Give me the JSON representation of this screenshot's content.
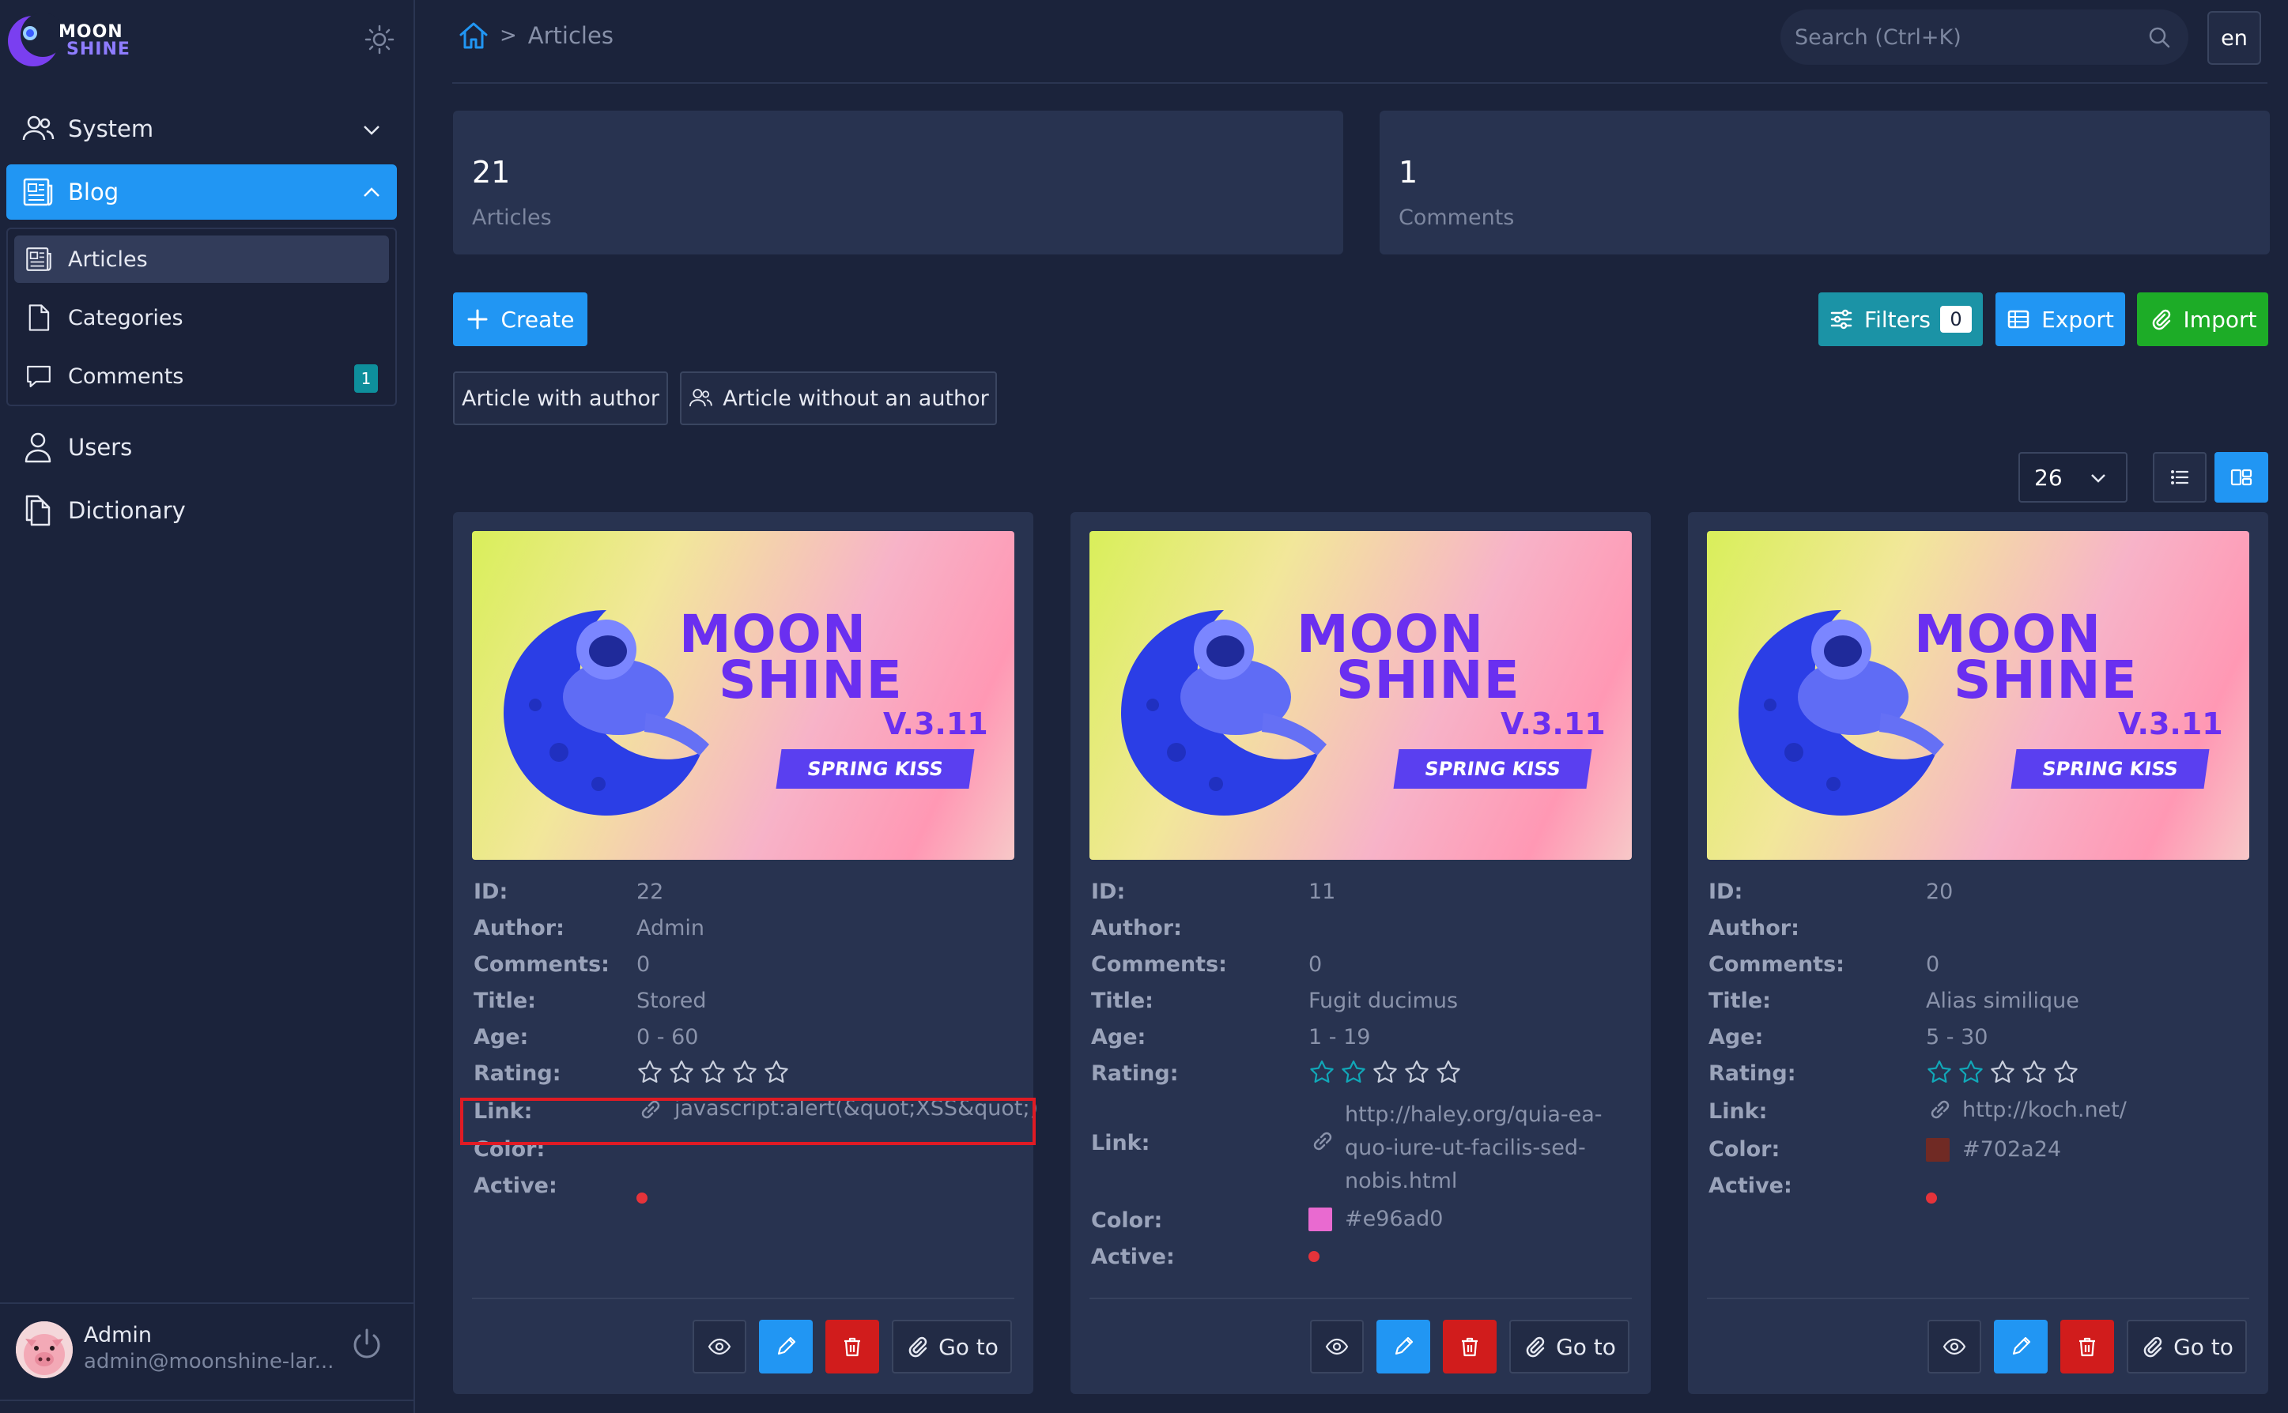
{
  "app": {
    "logo_line1": "MOON",
    "logo_line2": "SHINE"
  },
  "sidebar": {
    "items": [
      {
        "label": "System",
        "icon": "users-icon"
      },
      {
        "label": "Blog",
        "icon": "newspaper-icon"
      },
      {
        "label": "Users",
        "icon": "user-icon"
      },
      {
        "label": "Dictionary",
        "icon": "documents-icon"
      }
    ],
    "blog_sub": [
      {
        "label": "Articles",
        "icon": "newspaper-icon"
      },
      {
        "label": "Categories",
        "icon": "document-icon"
      },
      {
        "label": "Comments",
        "icon": "chat-icon",
        "badge": "1"
      }
    ]
  },
  "user": {
    "name": "Admin",
    "email": "admin@moonshine-lar..."
  },
  "topbar": {
    "breadcrumb_current": "Articles",
    "breadcrumb_separator": ">",
    "search_placeholder": "Search (Ctrl+K)",
    "lang": "en"
  },
  "metrics": [
    {
      "value": "21",
      "label": "Articles"
    },
    {
      "value": "1",
      "label": "Comments"
    }
  ],
  "actions": {
    "create": "Create",
    "filters": "Filters",
    "filters_count": "0",
    "export": "Export",
    "import": "Import"
  },
  "quick_filters": [
    "Article with author",
    "Article without an author"
  ],
  "pagination": {
    "per_page": "26"
  },
  "field_labels": {
    "id": "ID:",
    "author": "Author:",
    "comments": "Comments:",
    "title": "Title:",
    "age": "Age:",
    "rating": "Rating:",
    "link": "Link:",
    "color": "Color:",
    "active": "Active:"
  },
  "card_buttons": {
    "goto": "Go to"
  },
  "banner": {
    "title1": "MOON",
    "title2": "SHINE",
    "version": "V.3.11",
    "tag": "SPRING KISS"
  },
  "cards": [
    {
      "id": "22",
      "author": "Admin",
      "comments": "0",
      "title": "Stored",
      "age": "0 - 60",
      "rating": 0,
      "link": "javascript:alert(&quot;XSS&quot;)",
      "color": "",
      "active_color": "#e5333a"
    },
    {
      "id": "11",
      "author": "",
      "comments": "0",
      "title": "Fugit ducimus",
      "age": "1 - 19",
      "rating": 2,
      "link_lines": [
        "http://haley.org/quia-ea-",
        "quo-iure-ut-facilis-sed-",
        "nobis.html"
      ],
      "color": "#e96ad0",
      "active_color": "#e5333a"
    },
    {
      "id": "20",
      "author": "",
      "comments": "0",
      "title": "Alias similique",
      "age": "5 - 30",
      "rating": 2,
      "link": "http://koch.net/",
      "color": "#702a24",
      "active_color": "#e5333a"
    }
  ],
  "colors": {
    "accent": "#2196f3",
    "danger": "#d11c1c",
    "success": "#1dac27",
    "info": "#1b93a6",
    "star_filled": "#11a8b8",
    "highlight_border": "#e01b24"
  }
}
